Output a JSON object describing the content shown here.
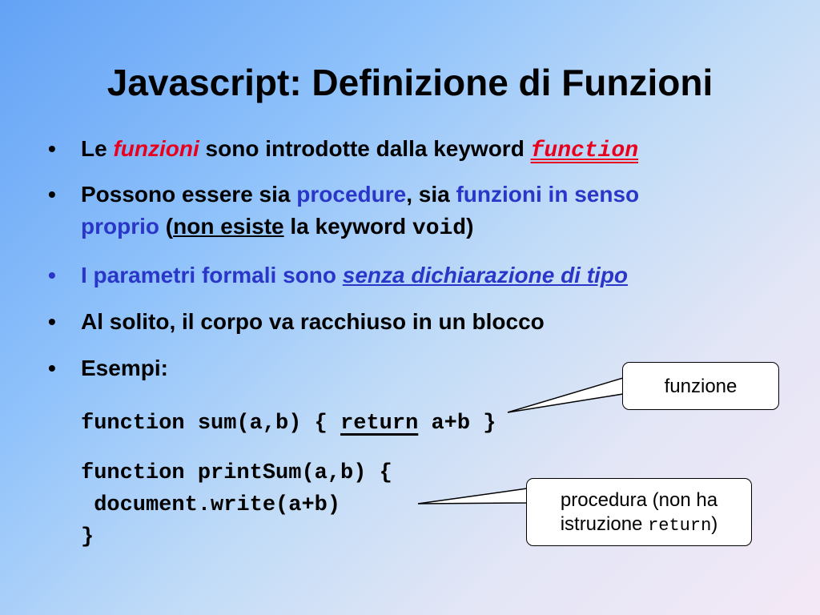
{
  "slide": {
    "title": "Javascript: Definizione di Funzioni",
    "bullet_marker": "•",
    "bullets": [
      {
        "pre": "Le ",
        "emph": "funzioni",
        "mid": " sono introdotte dalla keyword ",
        "code": "function"
      },
      {
        "pre": "Possono essere sia ",
        "blue1": "procedure",
        "mid": ", sia ",
        "blue2a": "funzioni in senso",
        "blue2b": "proprio",
        "paren_open": " (",
        "underlined": "non esiste",
        "after": " la keyword ",
        "code": "void",
        "paren_close": ")"
      },
      {
        "pre": "I parametri formali sono ",
        "emph": "senza dichiarazione di tipo"
      },
      {
        "text": "Al solito, il corpo va racchiuso in un blocco"
      },
      {
        "text": "Esempi:"
      }
    ],
    "code1": {
      "pre": "function sum(a,b) { ",
      "kw": "return",
      "post": " a+b }"
    },
    "code2": {
      "line1": "function printSum(a,b) {",
      "line2": " document.write(a+b)",
      "line3": "}"
    },
    "callouts": {
      "c1": "funzione",
      "c2_line1": "procedura (non ha",
      "c2_pre": "istruzione ",
      "c2_code": "return",
      "c2_post": ")"
    }
  },
  "colors": {
    "emphasis_red": "#e8001c",
    "keyword_blue": "#2a36c8"
  }
}
